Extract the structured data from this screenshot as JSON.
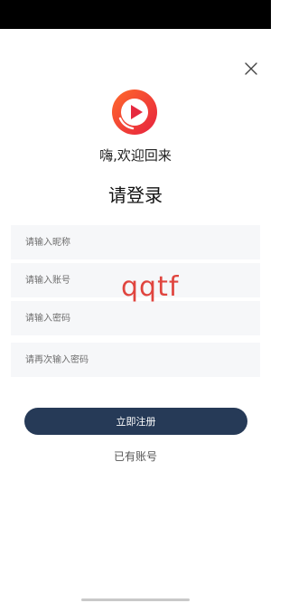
{
  "header": {
    "close_icon": "close-icon"
  },
  "logo": {
    "icon": "play-logo-icon",
    "colors": {
      "ring": "#f04a2e",
      "inner": "#e6293f",
      "play": "#ffffff"
    }
  },
  "greeting": "嗨,欢迎回来",
  "title": "请登录",
  "form": {
    "nickname_placeholder": "请输入昵称",
    "account_placeholder": "请输入账号",
    "password_placeholder": "请输入密码",
    "confirm_password_placeholder": "请再次输入密码"
  },
  "watermark": "qqtf",
  "register_button": "立即注册",
  "have_account_link": "已有账号",
  "colors": {
    "button_bg": "#263a57",
    "field_bg": "#f6f7f9",
    "watermark": "#e0453f"
  }
}
